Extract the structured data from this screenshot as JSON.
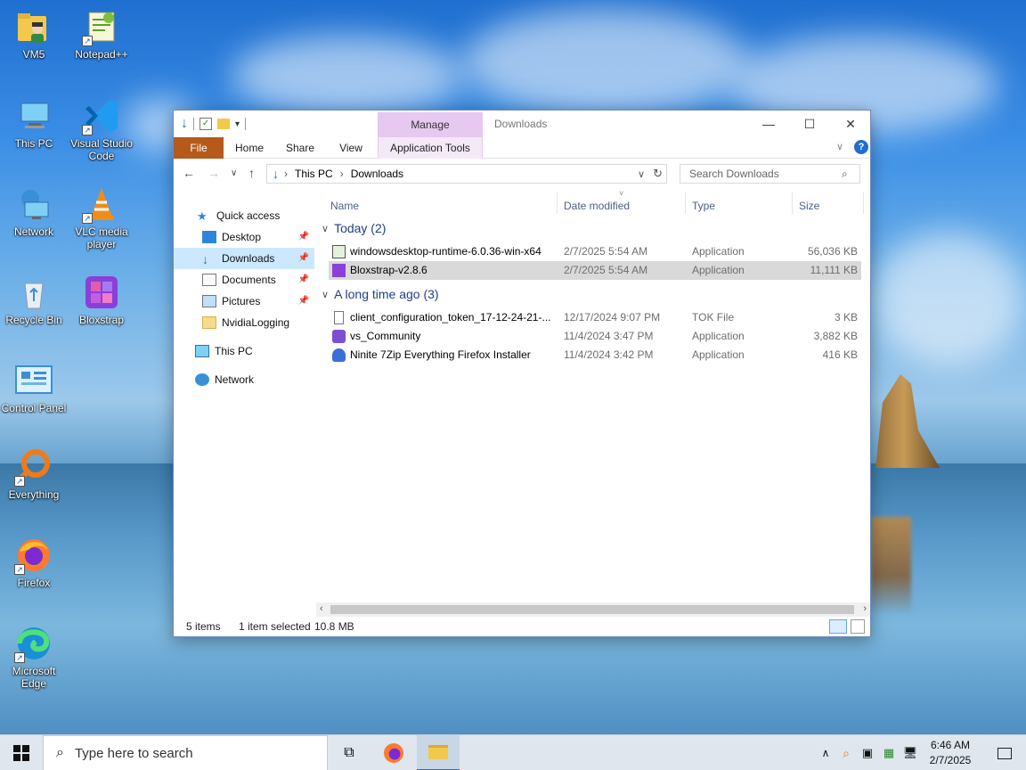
{
  "desktop": {
    "icons": [
      {
        "label": "VM5",
        "icon": "folder-user-icon"
      },
      {
        "label": "Notepad++",
        "icon": "notepadpp-icon"
      },
      {
        "label": "This PC",
        "icon": "computer-icon"
      },
      {
        "label": "Visual Studio Code",
        "icon": "vscode-icon"
      },
      {
        "label": "Network",
        "icon": "network-icon"
      },
      {
        "label": "VLC media player",
        "icon": "vlc-icon"
      },
      {
        "label": "Recycle Bin",
        "icon": "recycle-bin-icon"
      },
      {
        "label": "Bloxstrap",
        "icon": "bloxstrap-icon"
      },
      {
        "label": "Control Panel",
        "icon": "control-panel-icon"
      },
      {
        "label": "Everything",
        "icon": "everything-icon"
      },
      {
        "label": "Firefox",
        "icon": "firefox-icon"
      },
      {
        "label": "Microsoft Edge",
        "icon": "edge-icon"
      }
    ]
  },
  "explorer": {
    "title": "Downloads",
    "manage_label": "Manage",
    "tabs": {
      "file": "File",
      "home": "Home",
      "share": "Share",
      "view": "View",
      "app_tools": "Application Tools"
    },
    "breadcrumb": [
      "This PC",
      "Downloads"
    ],
    "search_placeholder": "Search Downloads",
    "nav": {
      "quick_access": "Quick access",
      "desktop": "Desktop",
      "downloads": "Downloads",
      "documents": "Documents",
      "pictures": "Pictures",
      "nvidia": "NvidiaLogging",
      "this_pc": "This PC",
      "network": "Network"
    },
    "columns": {
      "name": "Name",
      "date": "Date modified",
      "type": "Type",
      "size": "Size"
    },
    "groups": [
      {
        "label": "Today (2)",
        "files": [
          {
            "name": "windowsdesktop-runtime-6.0.36-win-x64",
            "date": "2/7/2025 5:54 AM",
            "type": "Application",
            "size": "56,036 KB"
          },
          {
            "name": "Bloxstrap-v2.8.6",
            "date": "2/7/2025 5:54 AM",
            "type": "Application",
            "size": "11,111 KB"
          }
        ]
      },
      {
        "label": "A long time ago (3)",
        "files": [
          {
            "name": "client_configuration_token_17-12-24-21-...",
            "date": "12/17/2024 9:07 PM",
            "type": "TOK File",
            "size": "3 KB"
          },
          {
            "name": "vs_Community",
            "date": "11/4/2024 3:47 PM",
            "type": "Application",
            "size": "3,882 KB"
          },
          {
            "name": "Ninite 7Zip Everything Firefox Installer",
            "date": "11/4/2024 3:42 PM",
            "type": "Application",
            "size": "416 KB"
          }
        ]
      }
    ],
    "status": {
      "items": "5 items",
      "selected": "1 item selected",
      "size": "10.8 MB"
    }
  },
  "taskbar": {
    "search_placeholder": "Type here to search",
    "time": "6:46 AM",
    "date": "2/7/2025"
  },
  "colors": {
    "file_tab": "#b55a1a",
    "manage_tab": "#e6c8f0",
    "selected_row": "#d9d9d9",
    "nav_selected": "#cce8ff",
    "group_text": "#1e3f87"
  }
}
